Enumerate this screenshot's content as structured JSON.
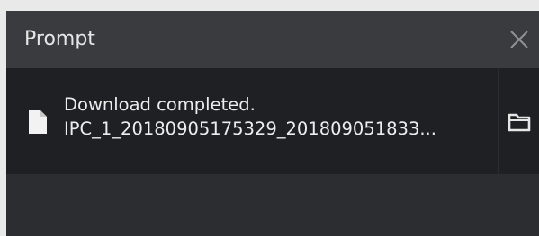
{
  "dialog": {
    "title": "Prompt",
    "close_icon": "close-icon"
  },
  "download": {
    "message": "Download completed.",
    "filename": "IPC_1_20180905175329_201809051833...",
    "file_icon": "document-icon",
    "open_folder_icon": "folder-icon"
  },
  "colors": {
    "titlebar_bg": "#393b3e",
    "row_bg": "#1f2023",
    "dialog_bg": "#2b2d30",
    "text": "#ededed"
  }
}
